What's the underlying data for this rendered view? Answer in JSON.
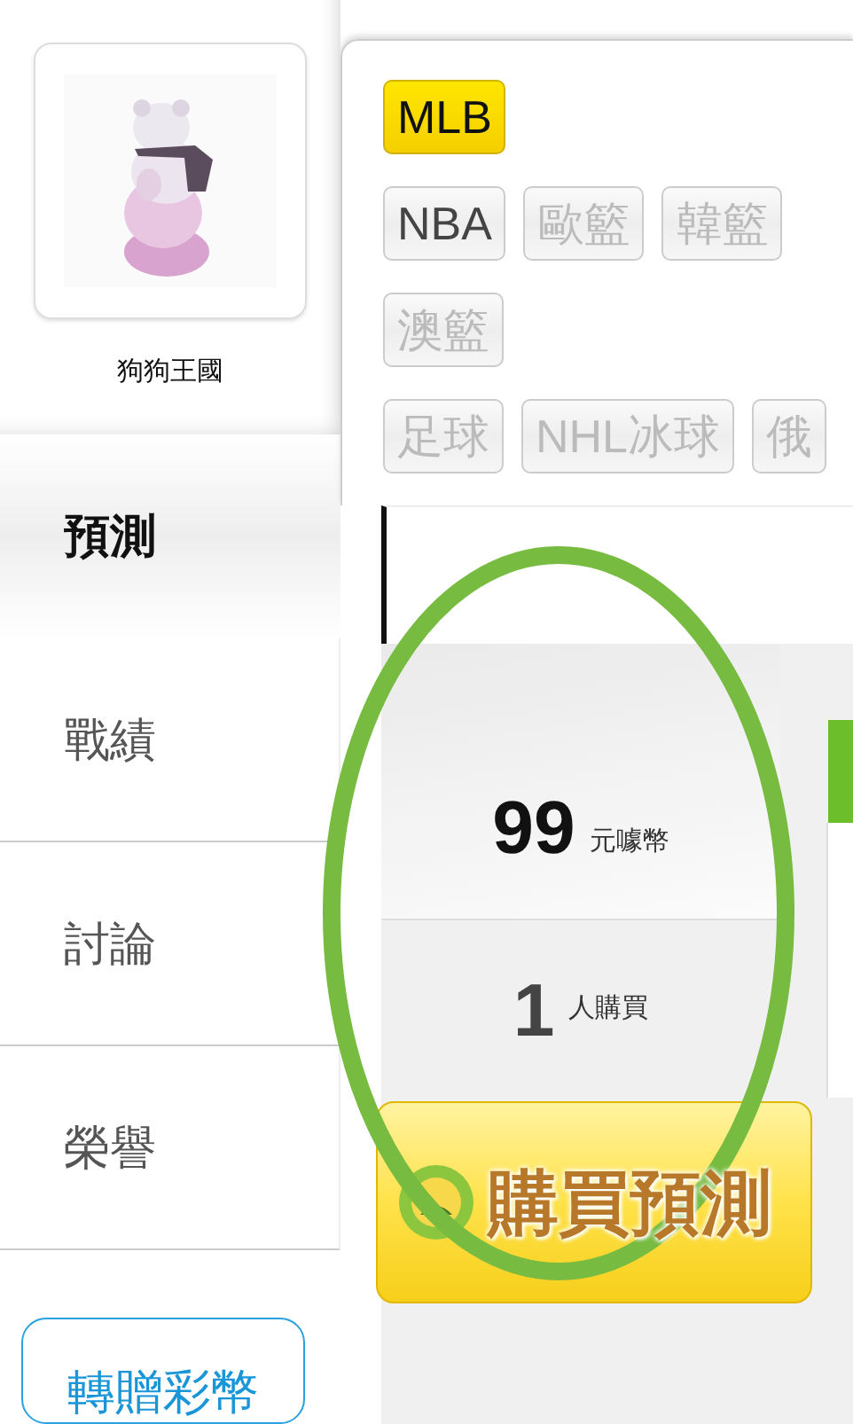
{
  "profile": {
    "name": "狗狗王國"
  },
  "nav": [
    {
      "label": "預測",
      "selected": true
    },
    {
      "label": "戰績",
      "selected": false
    },
    {
      "label": "討論",
      "selected": false
    },
    {
      "label": "榮譽",
      "selected": false
    }
  ],
  "gift_button": {
    "label": "轉贈彩幣"
  },
  "tag_lines": [
    [
      {
        "label": "MLB",
        "selected": true,
        "disabled": false
      }
    ],
    [
      {
        "label": "NBA",
        "selected": false,
        "disabled": false
      },
      {
        "label": "歐籃",
        "selected": false,
        "disabled": true
      },
      {
        "label": "韓籃",
        "selected": false,
        "disabled": true
      }
    ],
    [
      {
        "label": "澳籃",
        "selected": false,
        "disabled": true
      }
    ],
    [
      {
        "label": "足球",
        "selected": false,
        "disabled": true
      },
      {
        "label": "NHL冰球",
        "selected": false,
        "disabled": true
      },
      {
        "label": "俄",
        "selected": false,
        "disabled": true
      }
    ]
  ],
  "price": {
    "amount": "99",
    "unit": "元噱幣"
  },
  "buyers": {
    "count": "1",
    "unit": "人購買"
  },
  "buy_button": {
    "label": "購買預測"
  },
  "annotation": {
    "kind": "ellipse",
    "color": "#77bb41"
  }
}
